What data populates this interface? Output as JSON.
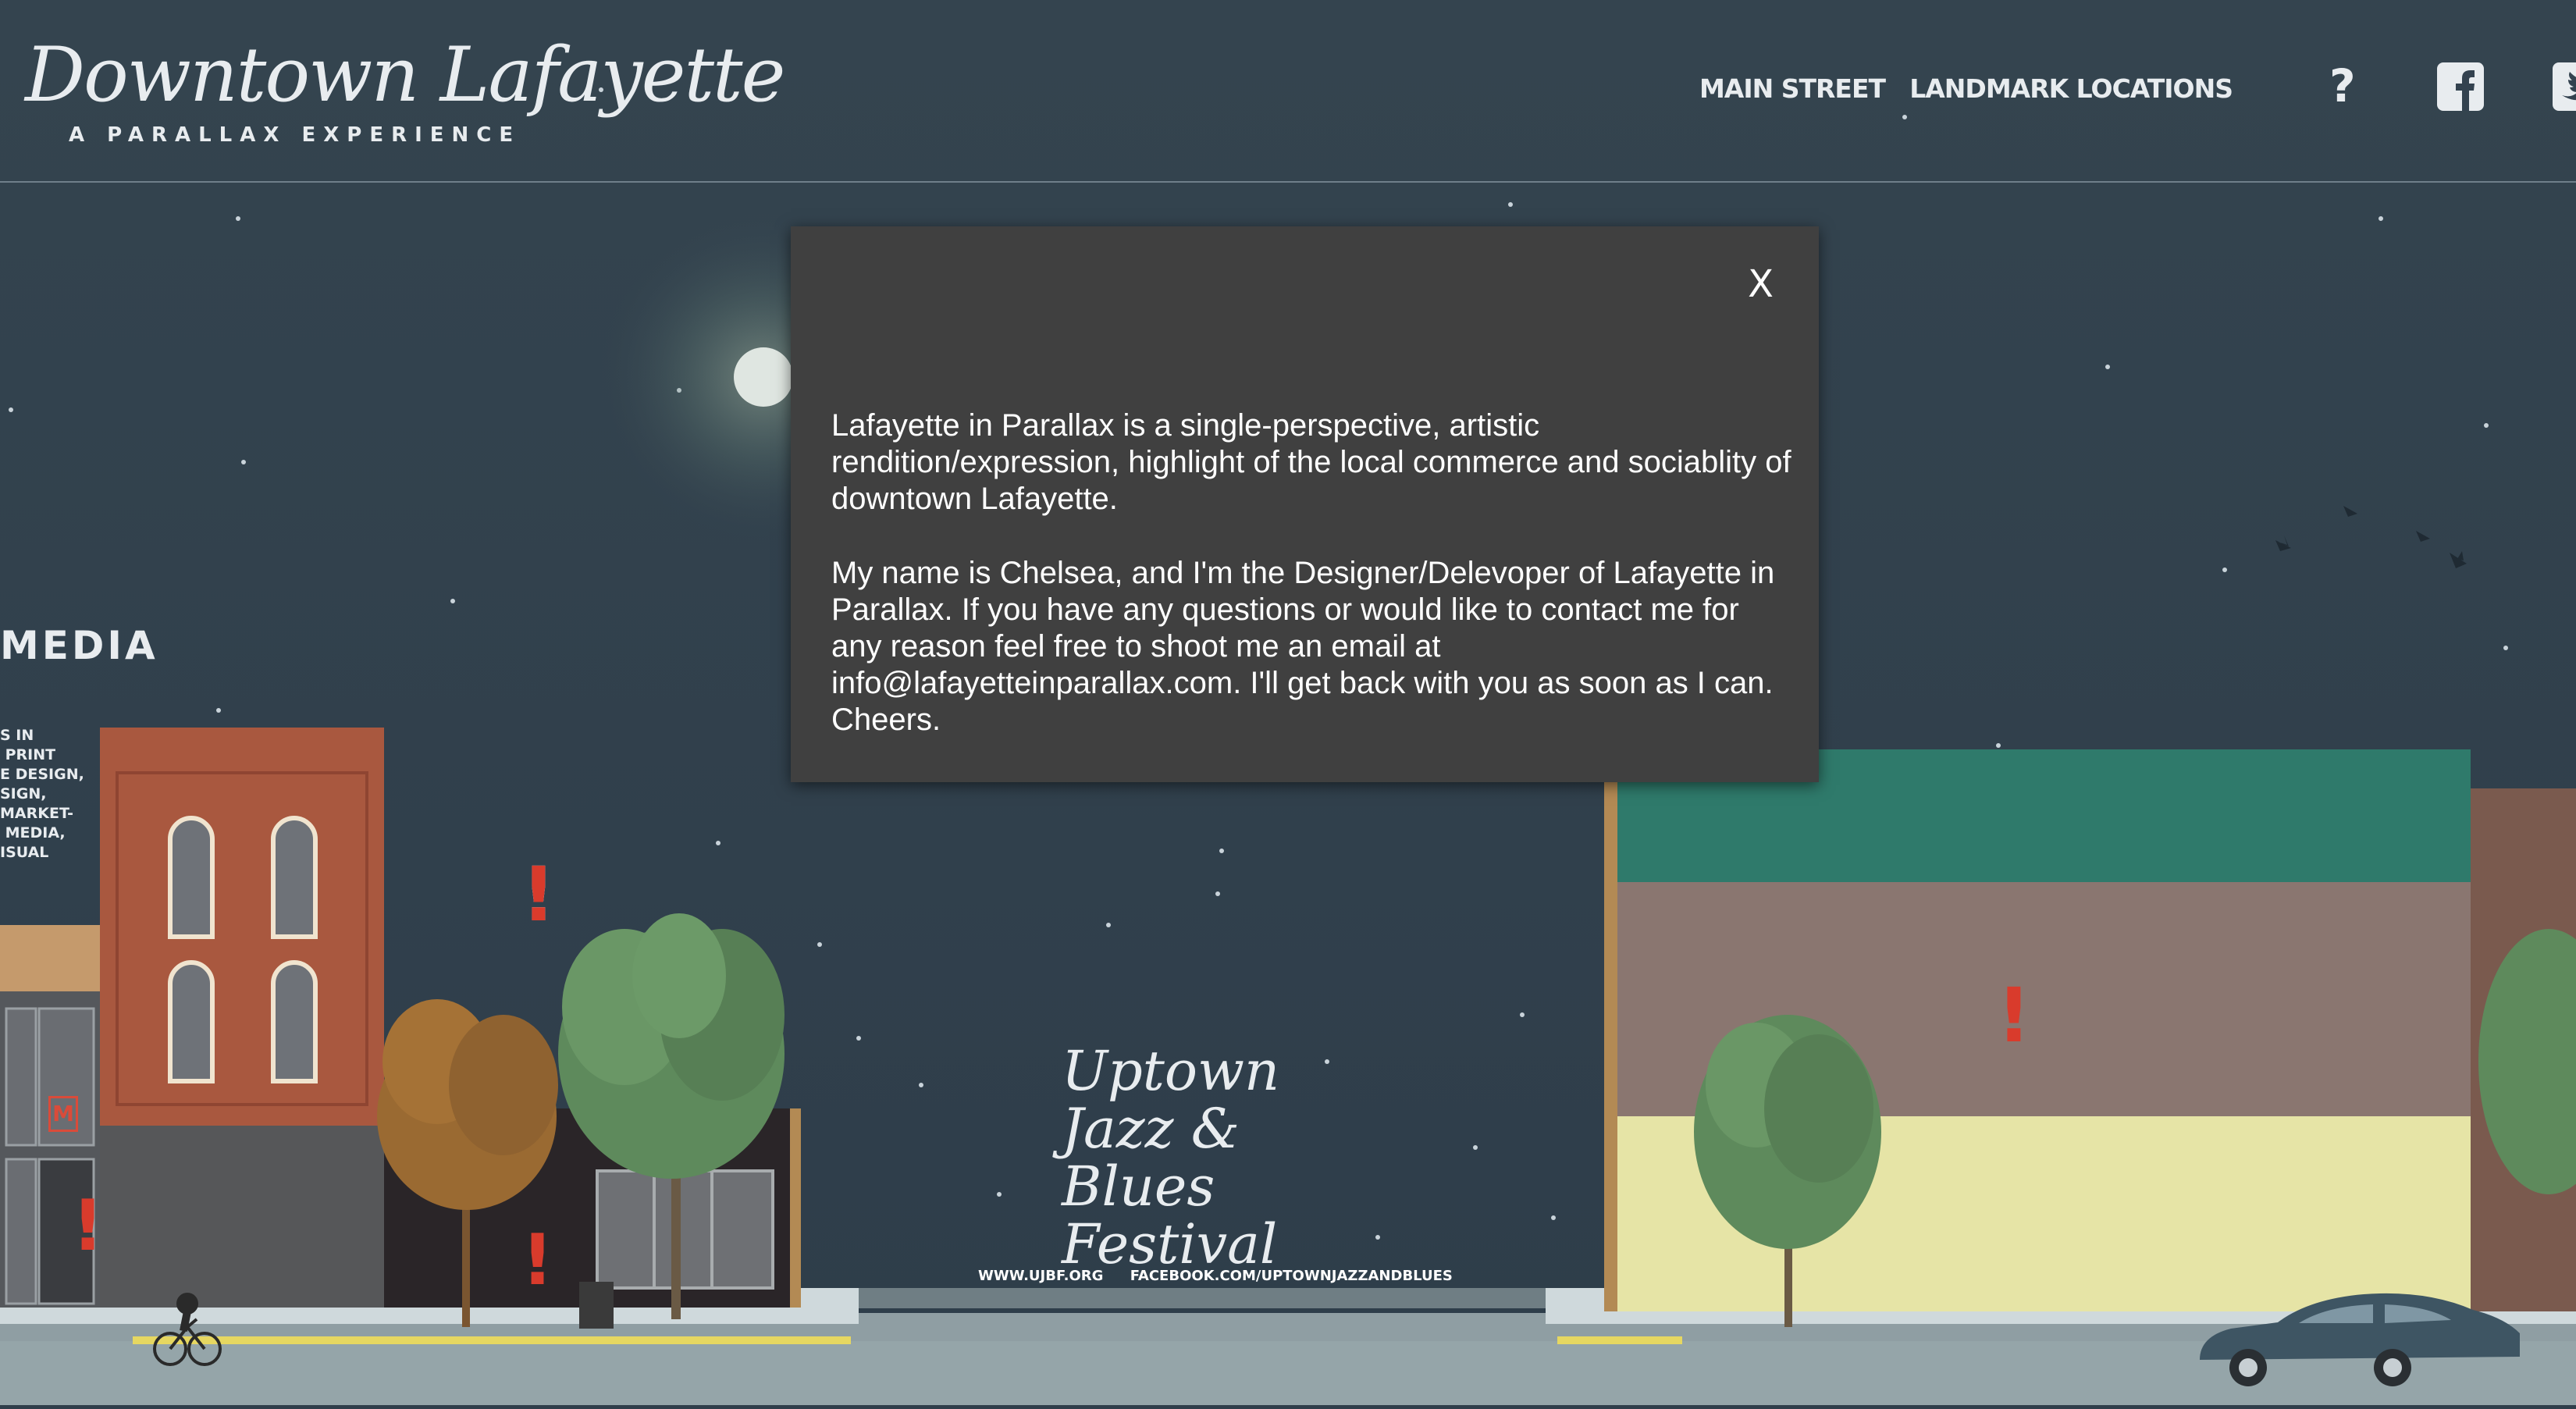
{
  "header": {
    "logo_script": "Downtown Lafayette",
    "logo_subtitle": "A PARALLAX EXPERIENCE"
  },
  "nav": {
    "items": [
      {
        "label": "MAIN STREET"
      },
      {
        "label": "LANDMARK LOCATIONS"
      }
    ],
    "help_label": "?",
    "icons": [
      "help-icon",
      "facebook-icon",
      "twitter-icon"
    ]
  },
  "modal": {
    "close_label": "X",
    "paragraph_1": "Lafayette in Parallax is a single-perspective, artistic rendition/expression, highlight of the local commerce and sociablity of downtown Lafayette.",
    "paragraph_2": "My name is Chelsea, and I'm the Designer/Delevoper of Lafayette in Parallax. If you have any questions or would like to contact me for any reason feel free to shoot me an email at info@lafayetteinparallax.com. I'll get back with you as soon as I can. Cheers."
  },
  "scene": {
    "building_sign_partial": "MEDIA",
    "building_text_partial": "S IN\n PRINT\nE DESIGN,\nSIGN,\nMARKET-\n MEDIA,\nISUAL",
    "shop_logo_letter": "M",
    "marker_symbol": "!",
    "festival_title": "Uptown Jazz & Blues Festival",
    "festival_link_1": "WWW.UJBF.ORG",
    "festival_link_2": "FACEBOOK.COM/UPTOWNJAZZANDBLUES"
  },
  "colors": {
    "sky_top": "#33424f",
    "sky_bottom": "#2f3e4b",
    "modal_bg": "#404040",
    "brick": "#a9583f",
    "building_teal": "#2f7a6b",
    "building_taupe": "#8a7670",
    "building_cream": "#e6e4a6",
    "road": "#8a9a9e",
    "marker_red": "#d93b2c",
    "tree_green": "#5e8a5c",
    "tree_orange": "#9a6a32"
  }
}
